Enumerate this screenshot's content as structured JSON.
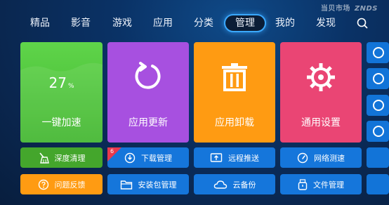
{
  "watermark": {
    "text": "当贝市场",
    "brand": "ZNDS"
  },
  "nav": {
    "items": [
      "精品",
      "影音",
      "游戏",
      "应用",
      "分类",
      "管理",
      "我的",
      "发现"
    ],
    "active": "管理"
  },
  "tiles": {
    "speedup": {
      "value": "27",
      "unit": "%",
      "label": "一键加速"
    },
    "update": {
      "label": "应用更新"
    },
    "uninstall": {
      "label": "应用卸载"
    },
    "settings": {
      "label": "通用设置"
    }
  },
  "buttons": {
    "deep_clean": "深度清理",
    "download": "下载管理",
    "download_badge": "6",
    "remote_push": "远程推送",
    "speed_test": "网络测速",
    "feedback": "问题反馈",
    "package_mgr": "安装包管理",
    "cloud_backup": "云备份",
    "file_mgr": "文件管理"
  },
  "colors": {
    "background": "#0a2d5c",
    "accent": "#3aa8ff",
    "green": "#4ec23a",
    "purple": "#a750e0",
    "orange": "#ff9b12",
    "pink": "#ea4574",
    "blue": "#1576db"
  }
}
